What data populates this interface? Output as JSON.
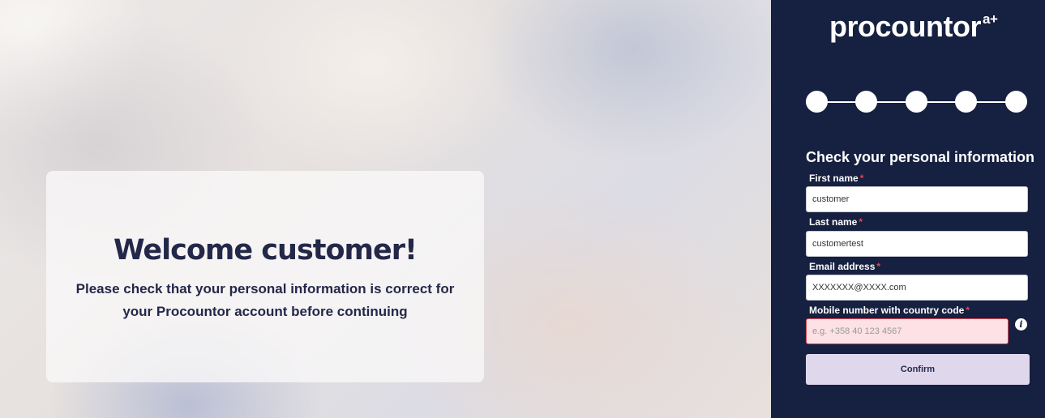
{
  "welcome": {
    "title": "Welcome customer!",
    "text": "Please check that your personal information is correct for your Procountor account before continuing"
  },
  "brand": {
    "logo": "procountor",
    "logo_suffix": "a+"
  },
  "stepper": {
    "steps": 5
  },
  "form": {
    "title": "Check your personal information",
    "required_mark": "*",
    "first_name": {
      "label": "First name",
      "value": "customer"
    },
    "last_name": {
      "label": "Last name",
      "value": "customertest"
    },
    "email": {
      "label": "Email address",
      "value": "XXXXXXX@XXXX.com"
    },
    "mobile": {
      "label": "Mobile number with country code",
      "placeholder": "e.g. +358 40 123 4567",
      "value": ""
    },
    "info_icon": "i",
    "confirm_label": "Confirm"
  },
  "colors": {
    "sidebar": "#162040",
    "error": "#e5434d",
    "invalid_field_bg": "#fde1e5",
    "confirm_bg": "#dfd7ec"
  }
}
